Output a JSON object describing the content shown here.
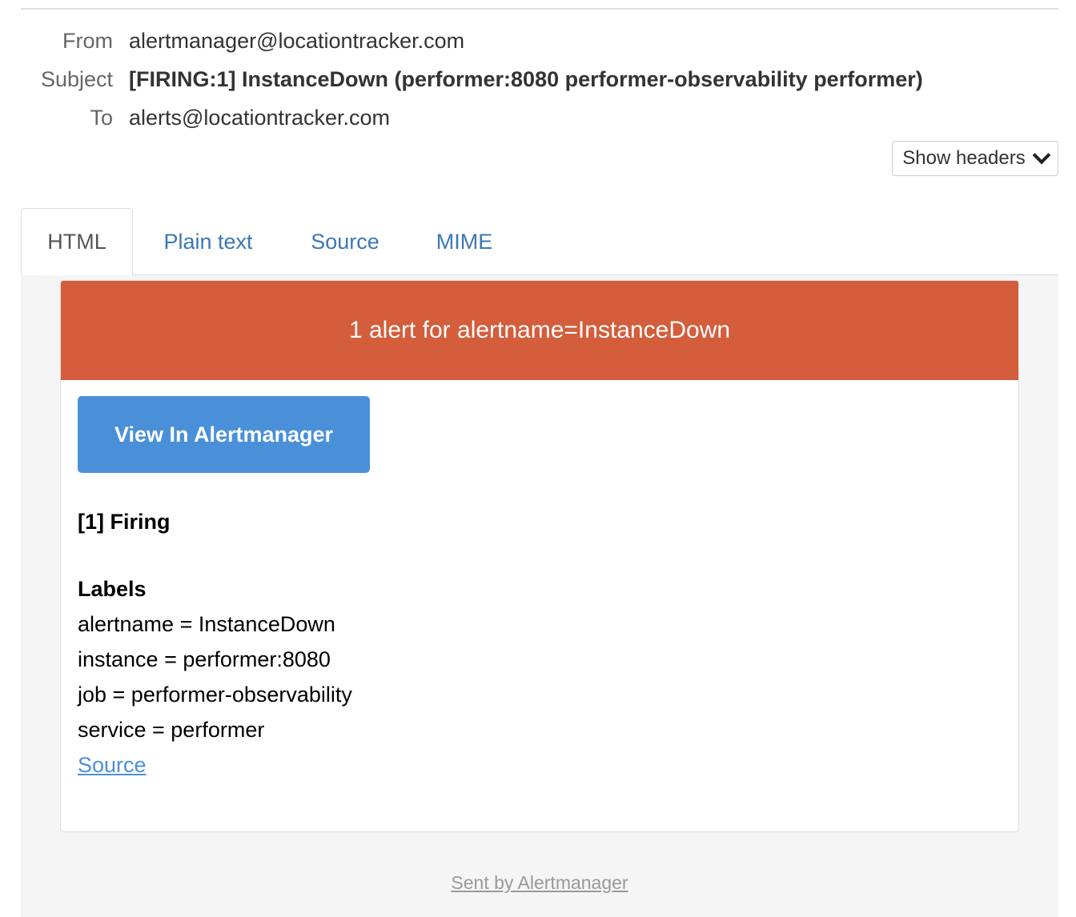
{
  "headers": {
    "from_label": "From",
    "from_value": "alertmanager@locationtracker.com",
    "subject_label": "Subject",
    "subject_value": "[FIRING:1] InstanceDown (performer:8080 performer-observability performer)",
    "to_label": "To",
    "to_value": "alerts@locationtracker.com",
    "show_headers_label": "Show headers"
  },
  "tabs": [
    {
      "label": "HTML",
      "active": true
    },
    {
      "label": "Plain text",
      "active": false
    },
    {
      "label": "Source",
      "active": false
    },
    {
      "label": "MIME",
      "active": false
    }
  ],
  "email": {
    "banner_text": "1 alert for alertname=InstanceDown",
    "view_button_label": "View In Alertmanager",
    "firing_heading": "[1] Firing",
    "labels_heading": "Labels",
    "labels": [
      "alertname = InstanceDown",
      "instance = performer:8080",
      "job = performer-observability",
      "service = performer"
    ],
    "source_link": "Source",
    "footer_link": "Sent by Alertmanager"
  },
  "colors": {
    "banner": "#d45d3b",
    "button": "#4a90d9",
    "link": "#3b78b5"
  }
}
